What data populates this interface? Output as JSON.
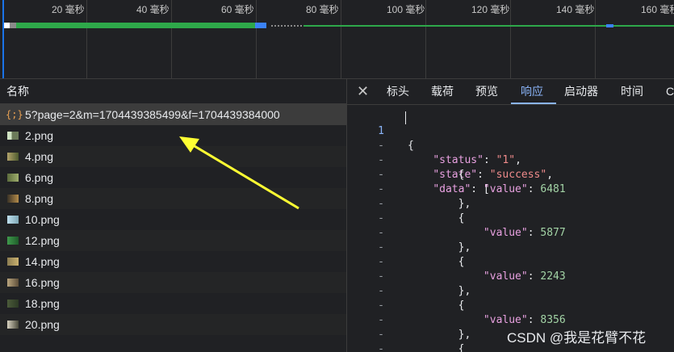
{
  "timeline": {
    "ticks": [
      "20 毫秒",
      "40 毫秒",
      "60 毫秒",
      "80 毫秒",
      "100 毫秒",
      "120 毫秒",
      "140 毫秒",
      "160 毫秒"
    ],
    "colors": {
      "green": "#2ea84a",
      "blue": "#3b82f6",
      "gray": "#8a8a8a"
    }
  },
  "requests": {
    "header": "名称",
    "items": [
      {
        "name": "5?page=2&m=1704439385499&f=1704439384000",
        "type": "json",
        "icon_glyph": "{;}"
      },
      {
        "name": "2.png",
        "type": "image"
      },
      {
        "name": "4.png",
        "type": "image"
      },
      {
        "name": "6.png",
        "type": "image"
      },
      {
        "name": "8.png",
        "type": "image"
      },
      {
        "name": "10.png",
        "type": "image"
      },
      {
        "name": "12.png",
        "type": "image"
      },
      {
        "name": "14.png",
        "type": "image"
      },
      {
        "name": "16.png",
        "type": "image"
      },
      {
        "name": "18.png",
        "type": "image"
      },
      {
        "name": "20.png",
        "type": "image"
      }
    ]
  },
  "detail": {
    "close_glyph": "✕",
    "tabs": [
      "标头",
      "载荷",
      "预览",
      "响应",
      "启动器",
      "时间",
      "Co"
    ],
    "active_tab": "响应",
    "line_numbers": [
      "1",
      "-",
      "-",
      "-",
      "-",
      "-",
      "-",
      "-",
      "-",
      "-",
      "-",
      "-",
      "-",
      "-",
      "-",
      "-",
      "-"
    ],
    "response": {
      "open": "{",
      "status_key": "\"status\"",
      "status_value": "\"1\"",
      "state_key": "\"state\"",
      "state_value": "\"success\"",
      "data_key": "\"data\"",
      "values": [
        "6481",
        "5877",
        "2243",
        "8356"
      ]
    }
  },
  "annotation": {
    "color": "#ffff33"
  },
  "watermark": "CSDN @我是花臂不花"
}
